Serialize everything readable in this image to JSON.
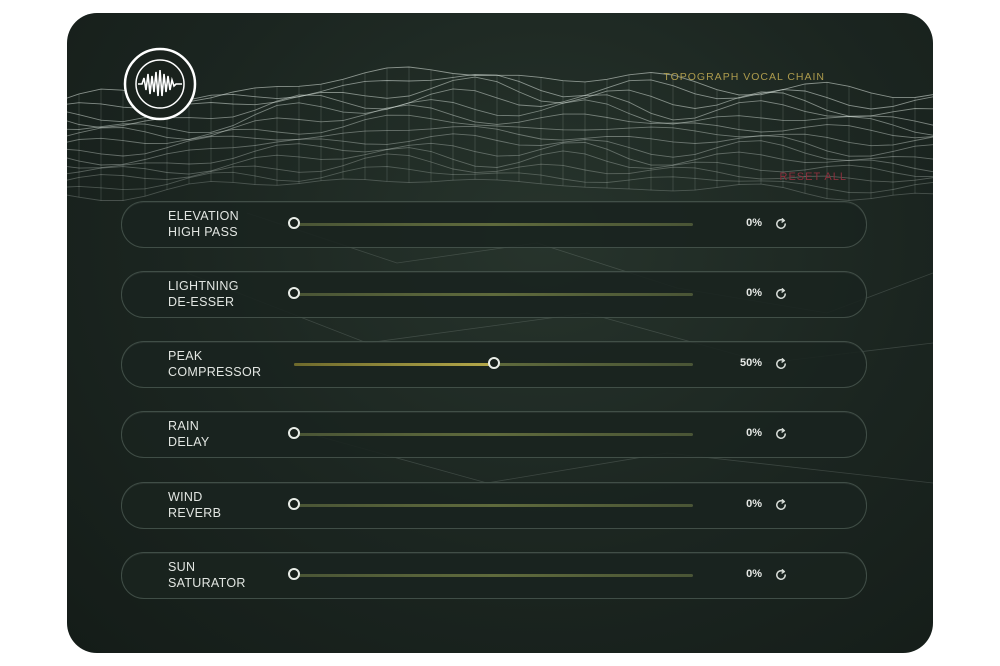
{
  "header": {
    "title": "TOPOGRAPH VOCAL CHAIN",
    "reset_all": "RESET ALL",
    "logo_icon": "vinyl-soundwave-logo-icon"
  },
  "colors": {
    "panel": "#1b2520",
    "accent_gold": "#bca751",
    "reset_red": "#8a2f3c",
    "text": "#e2e6e2"
  },
  "controls": [
    {
      "label": "ELEVATION\nHIGH PASS",
      "value": "0%",
      "level": 0
    },
    {
      "label": "LIGHTNING\nDE-ESSER",
      "value": "0%",
      "level": 0
    },
    {
      "label": "PEAK\nCOMPRESSOR",
      "value": "50%",
      "level": 0.5
    },
    {
      "label": "RAIN\nDELAY",
      "value": "0%",
      "level": 0
    },
    {
      "label": "WIND\nREVERB",
      "value": "0%",
      "level": 0
    },
    {
      "label": "SUN\nSATURATOR",
      "value": "0%",
      "level": 0
    }
  ]
}
